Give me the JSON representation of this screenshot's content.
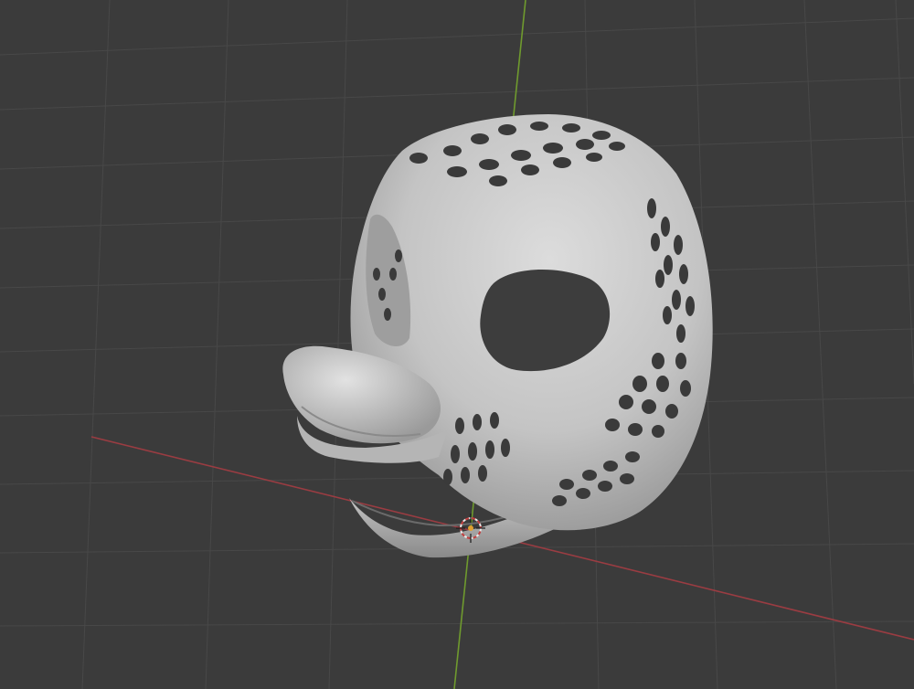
{
  "viewport": {
    "background_color": "#3b3b3b",
    "grid_color": "#4a4a4a",
    "y_axis_color": "#6f9a2e",
    "x_axis_color": "#9a3c42",
    "model": {
      "type": "3D mask mesh",
      "color": "#c9c9c9",
      "shading": "solid"
    },
    "origin_marker": "3d-cursor-icon"
  }
}
